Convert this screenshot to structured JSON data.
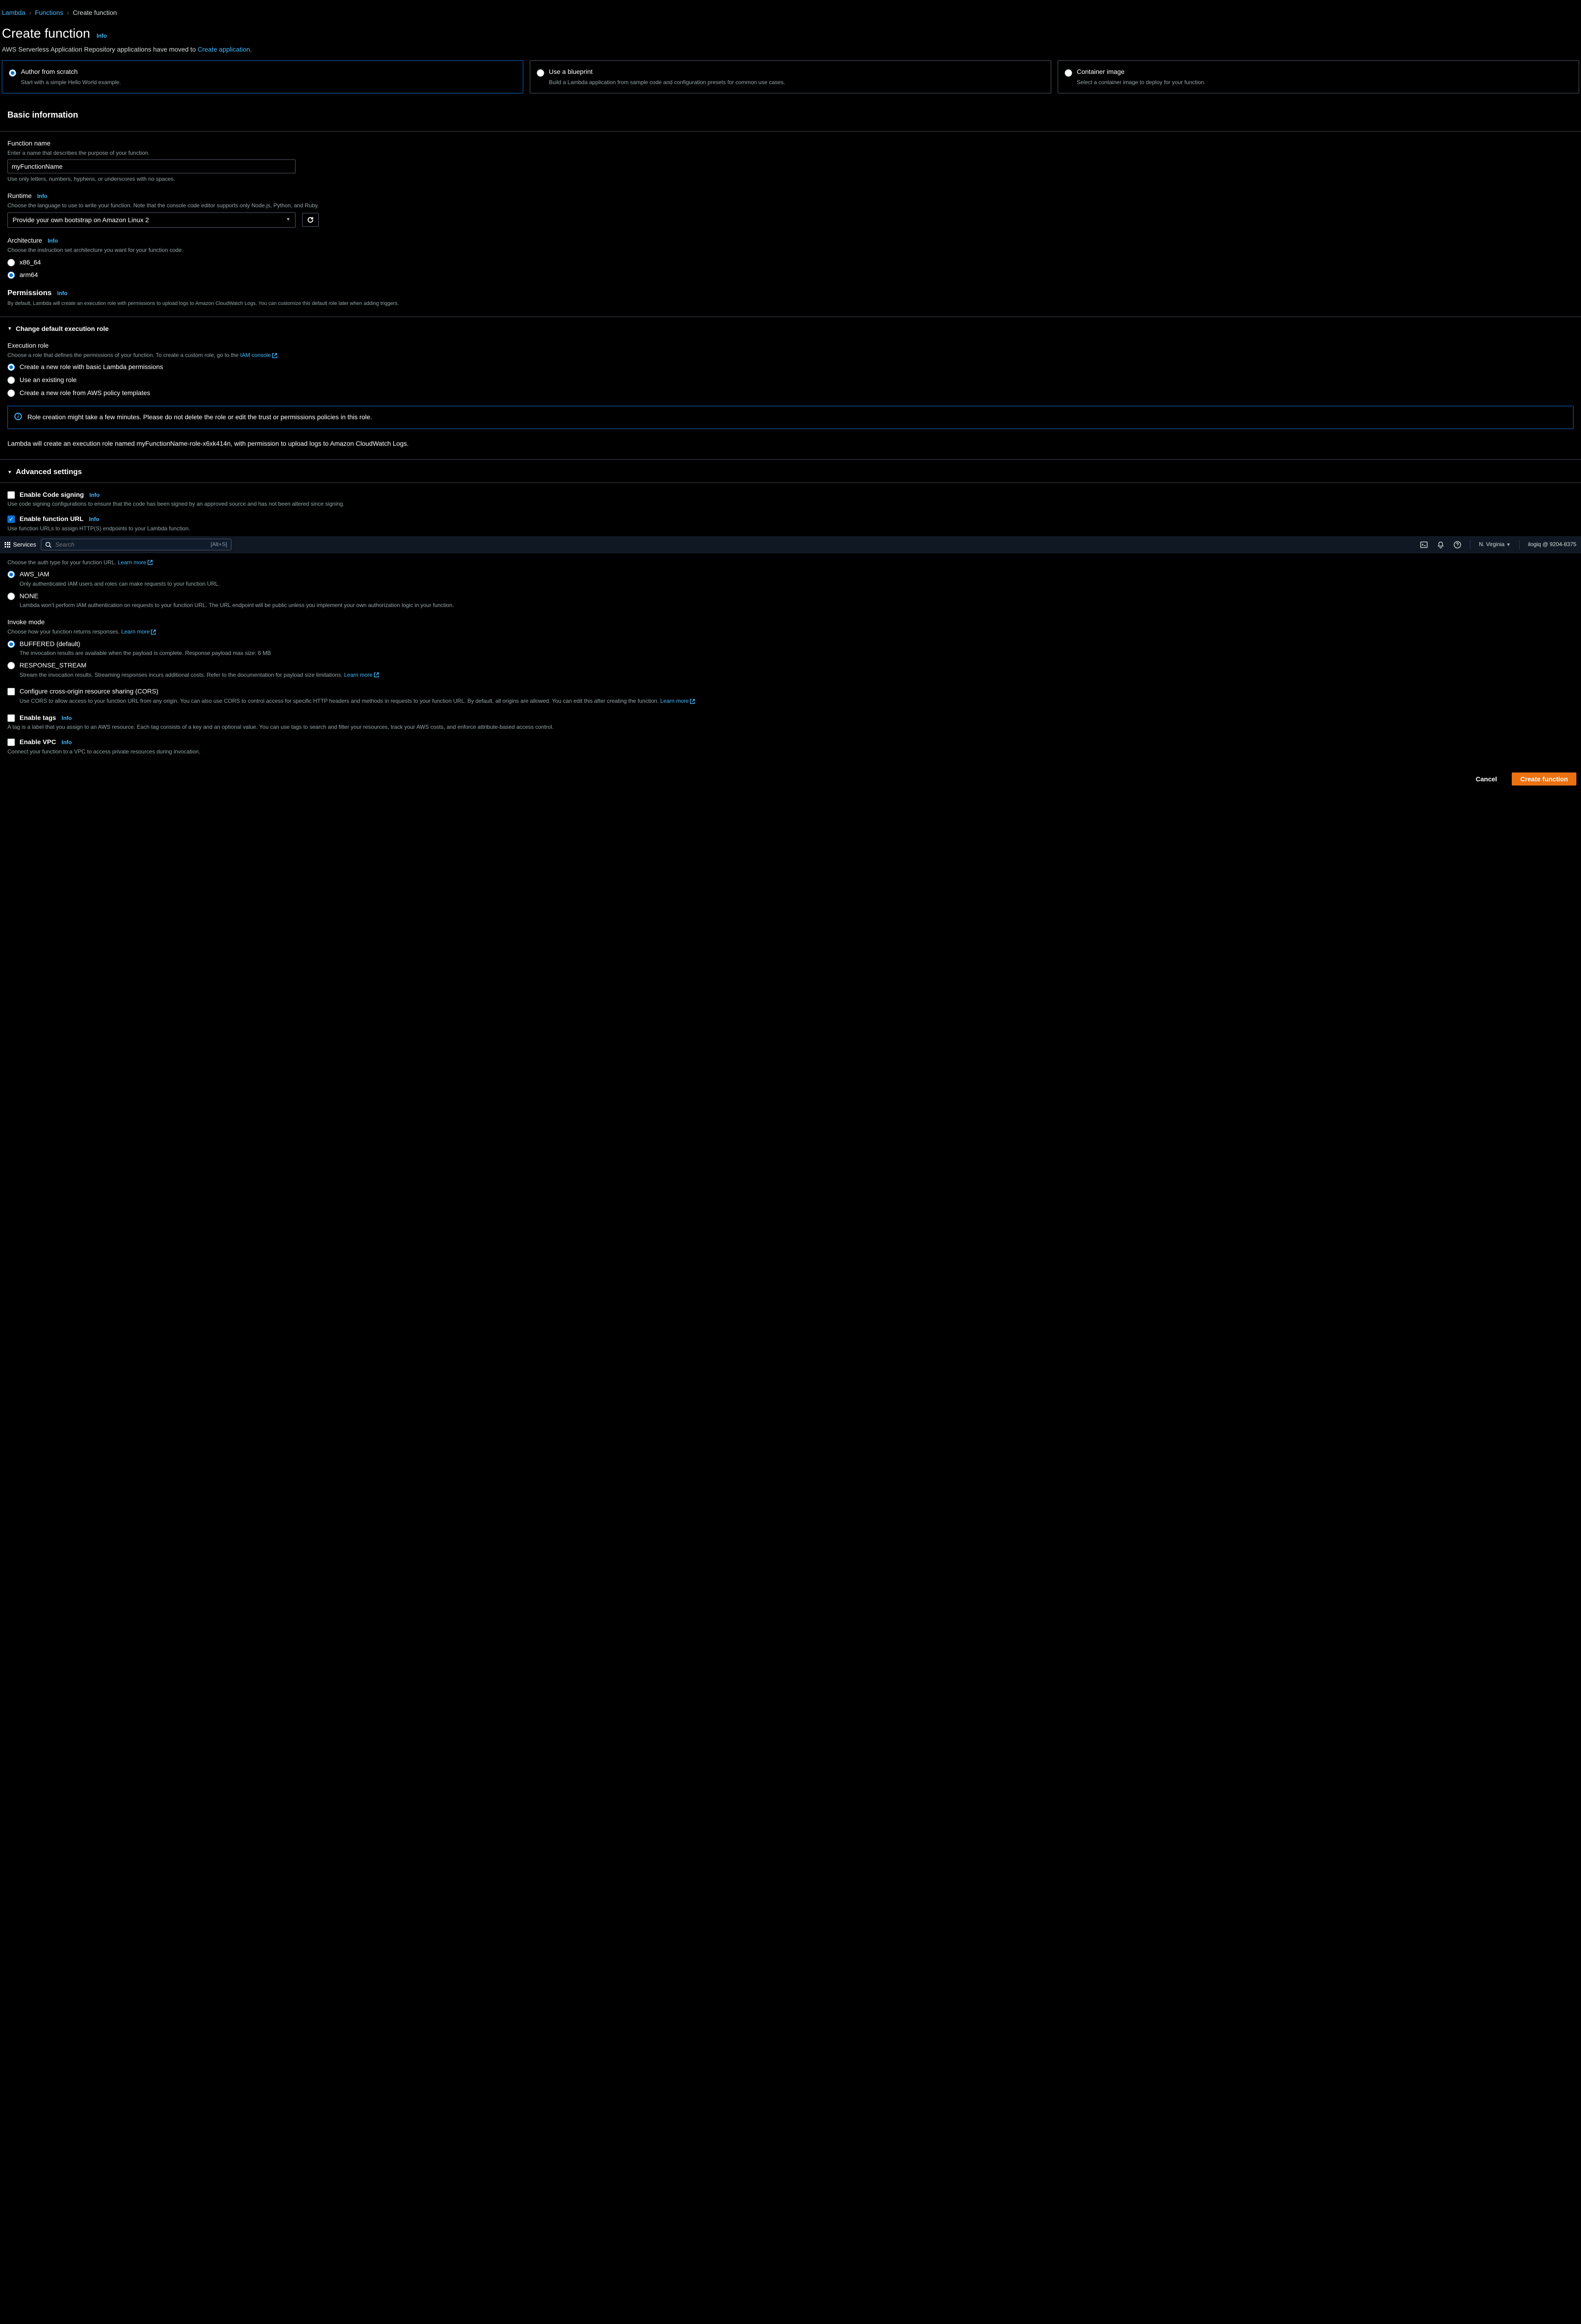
{
  "breadcrumb": {
    "lambda": "Lambda",
    "functions": "Functions",
    "current": "Create function"
  },
  "header": {
    "title": "Create function",
    "info": "Info",
    "moved_prefix": "AWS Serverless Application Repository applications have moved to ",
    "moved_link": "Create application",
    "moved_suffix": "."
  },
  "template_cards": {
    "scratch": {
      "title": "Author from scratch",
      "desc": "Start with a simple Hello World example."
    },
    "blueprint": {
      "title": "Use a blueprint",
      "desc": "Build a Lambda application from sample code and configuration presets for common use cases."
    },
    "container": {
      "title": "Container image",
      "desc": "Select a container image to deploy for your function."
    }
  },
  "basic": {
    "title": "Basic information",
    "fn_name_label": "Function name",
    "fn_name_desc": "Enter a name that describes the purpose of your function.",
    "fn_name_value": "myFunctionName",
    "fn_name_help": "Use only letters, numbers, hyphens, or underscores with no spaces.",
    "runtime_label": "Runtime",
    "runtime_info": "Info",
    "runtime_desc": "Choose the language to use to write your function. Note that the console code editor supports only Node.js, Python, and Ruby.",
    "runtime_value": "Provide your own bootstrap on Amazon Linux 2",
    "arch_label": "Architecture",
    "arch_info": "Info",
    "arch_desc": "Choose the instruction set architecture you want for your function code.",
    "arch_x86": "x86_64",
    "arch_arm": "arm64"
  },
  "permissions": {
    "title": "Permissions",
    "info": "Info",
    "desc": "By default, Lambda will create an execution role with permissions to upload logs to Amazon CloudWatch Logs. You can customize this default role later when adding triggers.",
    "expander": "Change default execution role",
    "exec_label": "Execution role",
    "exec_desc_prefix": "Choose a role that defines the permissions of your function. To create a custom role, go to the ",
    "exec_desc_link": "IAM console",
    "opt_new": "Create a new role with basic Lambda permissions",
    "opt_existing": "Use an existing role",
    "opt_template": "Create a new role from AWS policy templates",
    "alert": "Role creation might take a few minutes. Please do not delete the role or edit the trust or permissions policies in this role.",
    "summary": "Lambda will create an execution role named myFunctionName-role-x6xk414n, with permission to upload logs to Amazon CloudWatch Logs."
  },
  "advanced": {
    "title": "Advanced settings",
    "codesign_label": "Enable Code signing",
    "codesign_info": "Info",
    "codesign_desc": "Use code signing configurations to ensure that the code has been signed by an approved source and has not been altered since signing.",
    "fnurl_label": "Enable function URL",
    "fnurl_info": "Info",
    "fnurl_desc": "Use function URLs to assign HTTP(S) endpoints to your Lambda function.",
    "authtype_desc": "Choose the auth type for your function URL. ",
    "learn_more": "Learn more",
    "iam_label": "AWS_IAM",
    "iam_desc": "Only authenticated IAM users and roles can make requests to your function URL.",
    "none_label": "NONE",
    "none_desc": "Lambda won't perform IAM authentication on requests to your function URL. The URL endpoint will be public unless you implement your own authorization logic in your function.",
    "invoke_label": "Invoke mode",
    "invoke_desc": "Choose how your function returns responses. ",
    "buffered_label": "BUFFERED (default)",
    "buffered_desc": "The invocation results are available when the payload is complete. Response payload max size: 6 MB",
    "stream_label": "RESPONSE_STREAM",
    "stream_desc_prefix": "Stream the invocation results. Streaming responses incurs additional costs. Refer to the documentation for payload size limitations. ",
    "cors_label": "Configure cross-origin resource sharing (CORS)",
    "cors_desc_prefix": "Use CORS to allow access to your function URL from any origin. You can also use CORS to control access for specific HTTP headers and methods in requests to your function URL. By default, all origins are allowed. You can edit this after creating the function. ",
    "tags_label": "Enable tags",
    "tags_info": "Info",
    "tags_desc": "A tag is a label that you assign to an AWS resource. Each tag consists of a key and an optional value. You can use tags to search and filter your resources, track your AWS costs, and enforce attribute-based access control.",
    "vpc_label": "Enable VPC",
    "vpc_info": "Info",
    "vpc_desc": "Connect your function to a VPC to access private resources during invocation."
  },
  "navbar": {
    "services": "Services",
    "search_placeholder": "Search",
    "shortcut": "[Alt+S]",
    "region": "N. Virginia",
    "account": "ilogiq @ 9204-8375"
  },
  "footer": {
    "cancel": "Cancel",
    "create": "Create function"
  }
}
